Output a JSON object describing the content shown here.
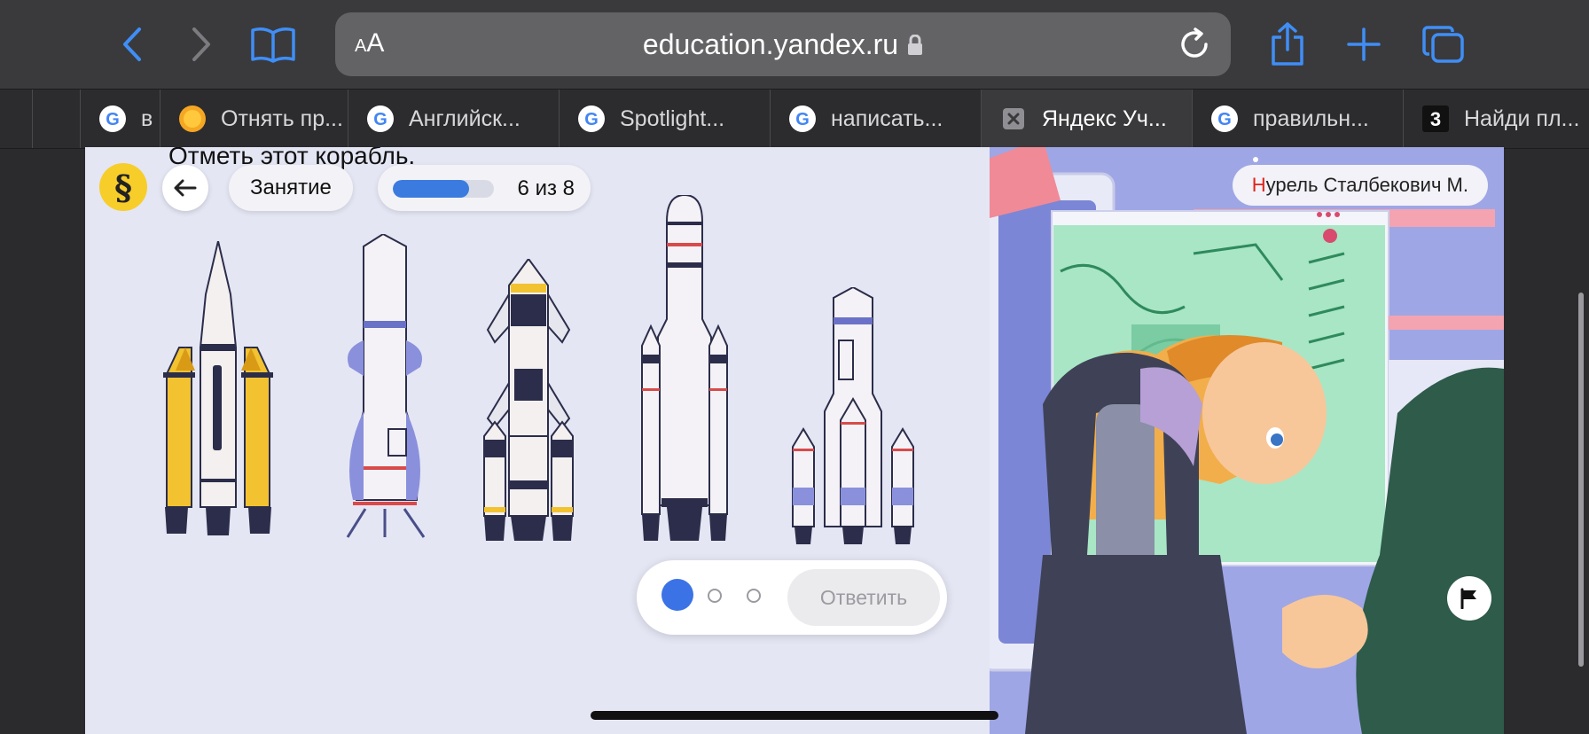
{
  "browser": {
    "url": "education.yandex.ru",
    "reader_label": "AA",
    "tabs": [
      {
        "title": "в",
        "icon": "google-icon"
      },
      {
        "title": "Отнять пр...",
        "icon": "sun-icon"
      },
      {
        "title": "Английск...",
        "icon": "google-icon"
      },
      {
        "title": "Spotlight...",
        "icon": "google-icon"
      },
      {
        "title": "написать...",
        "icon": "google-icon"
      },
      {
        "title": "Яндекс Уч...",
        "icon": "close-icon",
        "active": true
      },
      {
        "title": "правильн...",
        "icon": "google-icon"
      },
      {
        "title": "Найди пл...",
        "icon": "number-3-icon"
      }
    ]
  },
  "lesson": {
    "question": "Отметь этот корабль.",
    "logo_symbol": "§",
    "lesson_label": "Занятие",
    "progress_text": "6 из 8",
    "progress_fraction": 0.75,
    "user_initial": "Н",
    "user_name_rest": "урель Сталбекович М.",
    "submit_label": "Ответить",
    "pagination": {
      "count": 3,
      "active": 0
    }
  },
  "colors": {
    "accent": "#3b73e6",
    "logo": "#f7cd2a"
  }
}
